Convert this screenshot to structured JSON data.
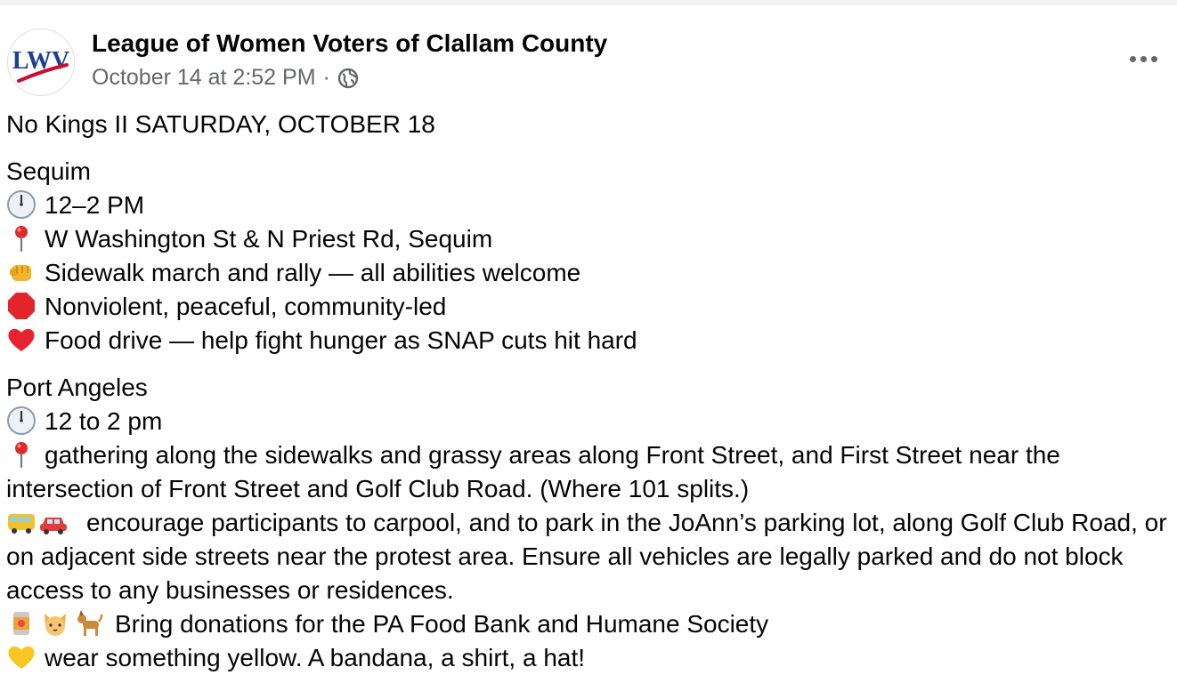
{
  "post": {
    "author": "League of Women Voters of Clallam County",
    "avatar_text": "LWV",
    "timestamp": "October 14 at 2:52 PM",
    "separator": "·",
    "audience_icon": "globe-icon"
  },
  "content": {
    "headline": "No Kings II SATURDAY,  OCTOBER 18",
    "sequim": {
      "title": "Sequim",
      "time": "12–2 PM",
      "location": "W Washington St & N Priest Rd, Sequim",
      "march": "Sidewalk march and rally — all abilities welcome",
      "nonviolent": "Nonviolent, peaceful, community-led",
      "food_drive": "Food drive — help fight hunger as SNAP cuts hit hard"
    },
    "port_angeles": {
      "title": "Port Angeles",
      "time": "12 to 2 pm",
      "location": "gathering along the sidewalks and grassy areas along Front Street, and First Street near the intersection of Front Street and Golf Club Road. (Where 101 splits.)",
      "parking": "encourage participants to carpool, and to park in the JoAnn’s parking lot, along Golf Club Road, or on adjacent side streets near the protest area.  Ensure all vehicles are legally parked and do not block access to any businesses or residences.",
      "donations": "Bring donations for the PA Food Bank and Humane Society",
      "yellow": "wear something yellow. A bandana,  a shirt, a hat!"
    }
  },
  "icons": [
    "clock-icon",
    "pin-icon",
    "fist-icon",
    "stop-sign-icon",
    "red-heart-icon",
    "bus-icon",
    "car-icon",
    "can-icon",
    "cat-icon",
    "dog-icon",
    "yellow-heart-icon",
    "more-options-icon"
  ],
  "colors": {
    "author_text": "#050505",
    "meta_text": "#65676b",
    "brand_blue": "#1c3f94",
    "brand_red": "#c8102e"
  }
}
